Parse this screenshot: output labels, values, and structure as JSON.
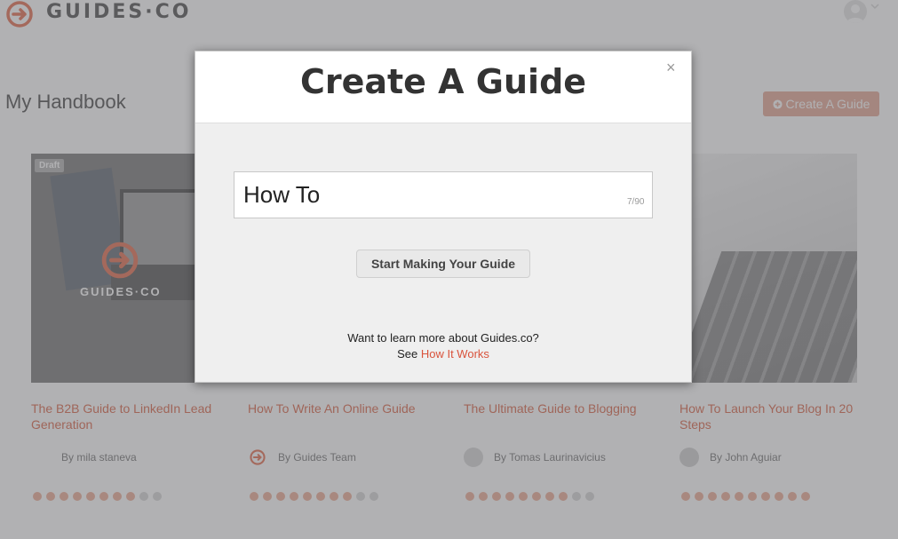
{
  "header": {
    "logo_text": "GUIDES·CO"
  },
  "handbook": {
    "title": "My Handbook",
    "create_button": "Create A Guide"
  },
  "cards": [
    {
      "badge": "Draft",
      "image_logo_text": "GUIDES·CO",
      "title": "The B2B Guide to LinkedIn Lead Generation",
      "author": "By mila staneva",
      "dots_filled": 8,
      "dots_total": 10
    },
    {
      "title": "How To Write An Online Guide",
      "author": "By Guides Team",
      "dots_filled": 8,
      "dots_total": 10
    },
    {
      "title": "The Ultimate Guide to Blogging",
      "author": "By Tomas Laurinavicius",
      "dots_filled": 8,
      "dots_total": 10
    },
    {
      "title": "How To Launch Your Blog In 20 Steps",
      "author": "By John Aguiar",
      "dots_filled": 10,
      "dots_total": 10
    }
  ],
  "modal": {
    "title": "Create A Guide",
    "close_symbol": "×",
    "input_value": "How To",
    "counter": "7/90",
    "start_button": "Start Making Your Guide",
    "learn_line1": "Want to learn more about Guides.co?",
    "learn_see": "See",
    "learn_link": "How It Works"
  },
  "colors": {
    "accent": "#e07d64",
    "link": "#d9533c"
  }
}
